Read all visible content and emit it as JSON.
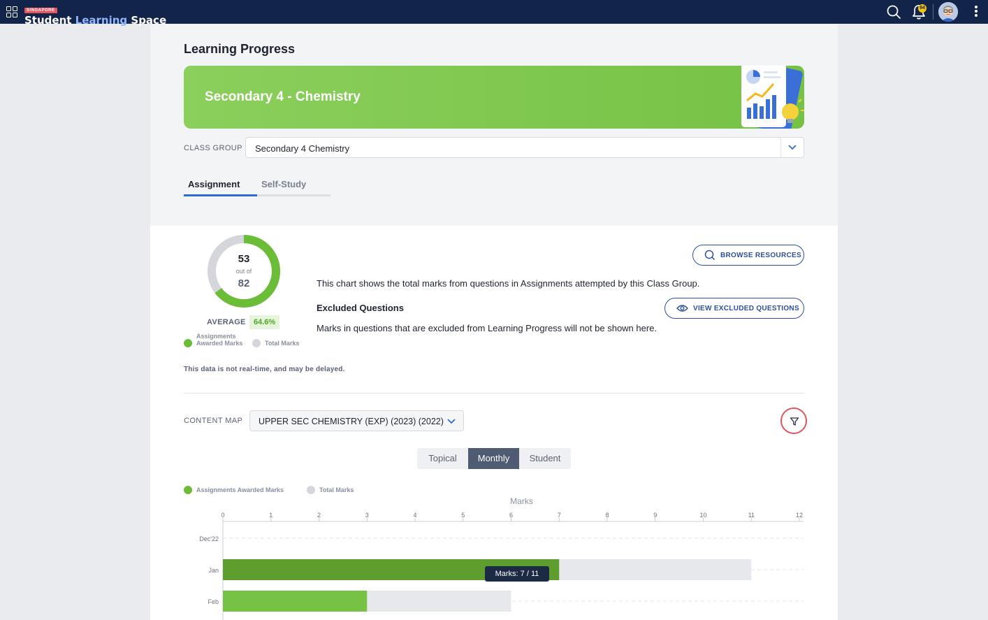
{
  "app": {
    "logo_tag": "SINGAPORE",
    "logo_part1": "Student",
    "logo_part2": "Learning",
    "logo_part3": "Space",
    "notification_count": "94"
  },
  "page": {
    "title": "Learning Progress",
    "banner_title": "Secondary 4 - Chemistry"
  },
  "class_group": {
    "label": "CLASS GROUP",
    "value": "Secondary 4 Chemistry"
  },
  "tabs": [
    {
      "label": "Assignment",
      "active": true
    },
    {
      "label": "Self-Study",
      "active": false
    }
  ],
  "summary": {
    "awarded": "53",
    "out_of": "out of",
    "total": "82",
    "average_label": "AVERAGE",
    "average_value": "64.6%",
    "legend_awarded": "Assignments Awarded Marks",
    "legend_total": "Total Marks",
    "delay_note": "This data is not real-time, and may be delayed.",
    "description": "This chart shows the total marks from questions in Assignments attempted by this Class Group.",
    "excluded_title": "Excluded Questions",
    "excluded_desc": "Marks in questions that are excluded from Learning Progress will not be shown here.",
    "browse_label": "BROWSE RESOURCES",
    "view_excluded_label": "VIEW EXCLUDED QUESTIONS"
  },
  "content_map": {
    "label": "CONTENT MAP",
    "value": "UPPER SEC CHEMISTRY (EXP) (2023) (2022)"
  },
  "view_toggle": {
    "options": [
      "Topical",
      "Monthly",
      "Student"
    ],
    "selected": "Monthly"
  },
  "chart_legend": {
    "awarded": "Assignments Awarded Marks",
    "total": "Total Marks"
  },
  "colors": {
    "brand_navy": "#13244a",
    "green": "#76c245",
    "green_dark": "#5e9e2e",
    "grey_bar": "#e6e8ec",
    "accent_blue": "#2d4fa0"
  },
  "tooltip": "Marks: 7 / 11",
  "chart_data": {
    "type": "bar",
    "orientation": "horizontal",
    "xlabel": "Marks",
    "xlim": [
      0,
      12
    ],
    "xticks": [
      0,
      1,
      2,
      3,
      4,
      5,
      6,
      7,
      8,
      9,
      10,
      11,
      12
    ],
    "categories": [
      "Dec'22",
      "Jan",
      "Feb"
    ],
    "series": [
      {
        "name": "Assignments Awarded Marks",
        "values": [
          0,
          7,
          3
        ]
      },
      {
        "name": "Total Marks",
        "values": [
          0,
          11,
          6
        ]
      }
    ],
    "legend": "top-left",
    "grid": true
  }
}
